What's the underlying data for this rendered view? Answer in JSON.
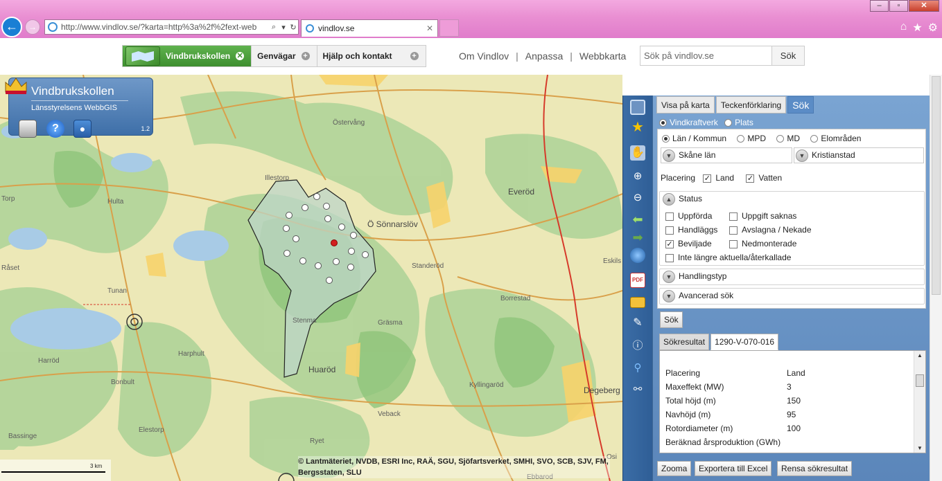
{
  "browser": {
    "address": "http://www.vindlov.se/?karta=http%3a%2f%2fext-web",
    "address_host": "www.vindlov.se",
    "tab_title": "vindlov.se"
  },
  "site": {
    "menu": [
      {
        "label": "Vindbrukskollen",
        "active": true
      },
      {
        "label": "Genvägar",
        "active": false
      },
      {
        "label": "Hjälp och kontakt",
        "active": false
      }
    ],
    "links": [
      "Om Vindlov",
      "Anpassa",
      "Webbkarta"
    ],
    "search_placeholder": "Sök på vindlov.se",
    "search_button": "Sök"
  },
  "logo_box": {
    "title": "Vindbrukskollen",
    "subtitle": "Länsstyrelsens WebbGIS",
    "version": "1.2"
  },
  "map": {
    "place_names": [
      "Östervång",
      "Illestorp",
      "Hulta",
      "Ö Sönnarslöv",
      "Everöd",
      "Råset",
      "Tunan",
      "Standeröd",
      "Borrestad",
      "Stenma",
      "Gräsma",
      "Harröd",
      "Harphult",
      "Huaröd",
      "Bonbult",
      "Kyllingaröd",
      "Degeberg",
      "Elestorp",
      "Veback",
      "Ryet",
      "Bassinge",
      "Eskils",
      "Ebbarod",
      "Osi"
    ],
    "scale_label": "3 km",
    "attribution": "© Lantmäteriet, NVDB, ESRI Inc, RAÄ, SGU, Sjöfartsverket, SMHI, SVO, SCB, SJV, FM, Bergsstaten, SLU"
  },
  "panel": {
    "tabs": [
      "Visa på karta",
      "Teckenförklaring",
      "Sök"
    ],
    "active_tab": "Sök",
    "mode": {
      "options": [
        "Vindkraftverk",
        "Plats"
      ],
      "selected": "Vindkraftverk"
    },
    "area": {
      "options": [
        "Län / Kommun",
        "MPD",
        "MD",
        "Elområden"
      ],
      "selected": "Län / Kommun"
    },
    "county": "Skåne län",
    "municipality": "Kristianstad",
    "placering": {
      "label": "Placering",
      "land": "Land",
      "vatten": "Vatten"
    },
    "status": {
      "title": "Status",
      "items": [
        {
          "label": "Uppförda",
          "checked": false
        },
        {
          "label": "Uppgift saknas",
          "checked": false
        },
        {
          "label": "Handläggs",
          "checked": false
        },
        {
          "label": "Avslagna / Nekade",
          "checked": false
        },
        {
          "label": "Beviljade",
          "checked": true
        },
        {
          "label": "Nedmonterade",
          "checked": false
        },
        {
          "label": "Inte längre aktuella/återkallade",
          "checked": false
        }
      ]
    },
    "handlingstyp": "Handlingstyp",
    "avancerad": "Avancerad sök",
    "search_button": "Sök",
    "result_tabs": [
      "Sökresultat",
      "1290-V-070-016"
    ],
    "results": [
      {
        "k": "Placering",
        "v": "Land"
      },
      {
        "k": "Maxeffekt (MW)",
        "v": "3"
      },
      {
        "k": "Total höjd (m)",
        "v": "150"
      },
      {
        "k": "Navhöjd (m)",
        "v": "95"
      },
      {
        "k": "Rotordiameter (m)",
        "v": "100"
      },
      {
        "k": "Beräknad årsproduktion (GWh)",
        "v": ""
      }
    ],
    "footer_buttons": [
      "Zooma",
      "Exportera till Excel",
      "Rensa sökresultat"
    ]
  }
}
